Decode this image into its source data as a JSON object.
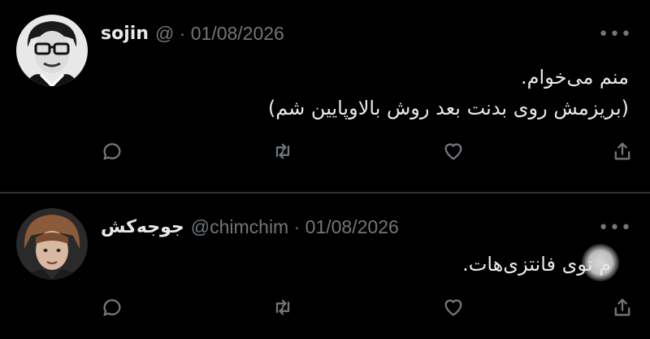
{
  "tweets": [
    {
      "name": "sojin",
      "meta": "@ · 01/08/2026",
      "more": "•••",
      "lines": [
        "منم می‌خوام.",
        "(بریزمش روی بدنت بعد روش بالاوپایین شم)"
      ]
    },
    {
      "name": "جوجه‌کش",
      "meta": "@chimchim · 01/08/2026",
      "more": "•••",
      "lines": [
        "م توی فانتزی‌هات."
      ]
    }
  ],
  "actions": [
    "reply-icon",
    "retweet-icon",
    "like-icon",
    "share-icon"
  ],
  "colors": {
    "background": "#000000",
    "text": "#e7e9ea",
    "muted": "#71767b",
    "divider": "#2f3336"
  }
}
